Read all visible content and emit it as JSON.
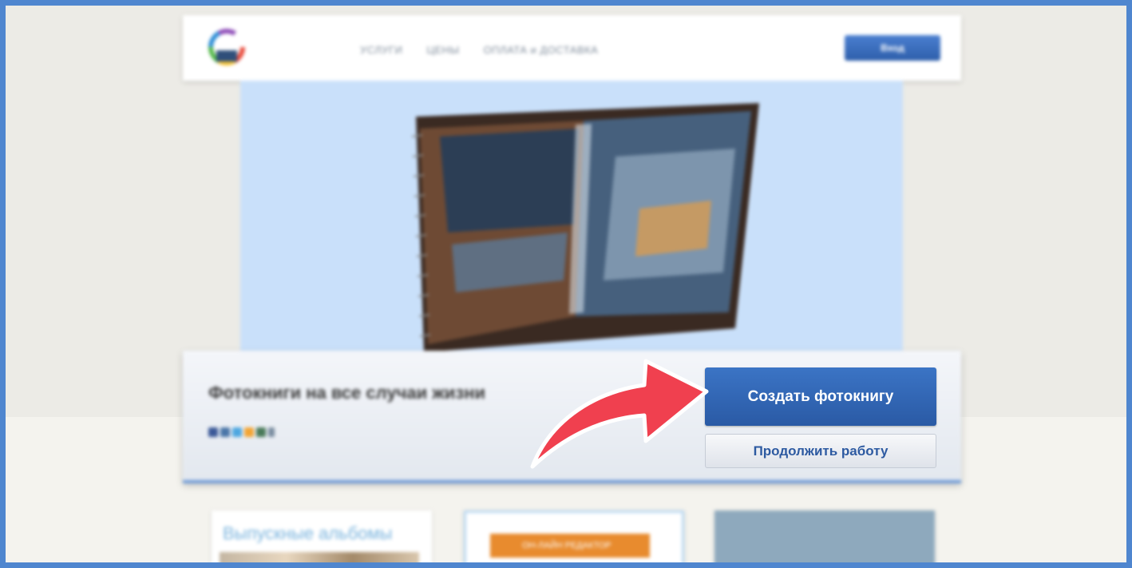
{
  "header": {
    "nav": [
      "УСЛУГИ",
      "ЦЕНЫ",
      "ОПЛАТА и ДОСТАВКА"
    ],
    "login_label": "Вход"
  },
  "cta": {
    "tagline": "Фотокниги на все случаи жизни",
    "create_label": "Создать фотокнигу",
    "continue_label": "Продолжить работу"
  },
  "cards": {
    "card1_title": "Выпускные альбомы",
    "card2_badge": "ОН-ЛАЙН РЕДАКТОР"
  },
  "colors": {
    "frame": "#4f86cf",
    "primary_button": "#3b74c5",
    "arrow": "#f0404f",
    "hero_bg": "#c9e0fa"
  },
  "icons": [
    "logo-icon",
    "social-icons",
    "curved-arrow-icon"
  ]
}
